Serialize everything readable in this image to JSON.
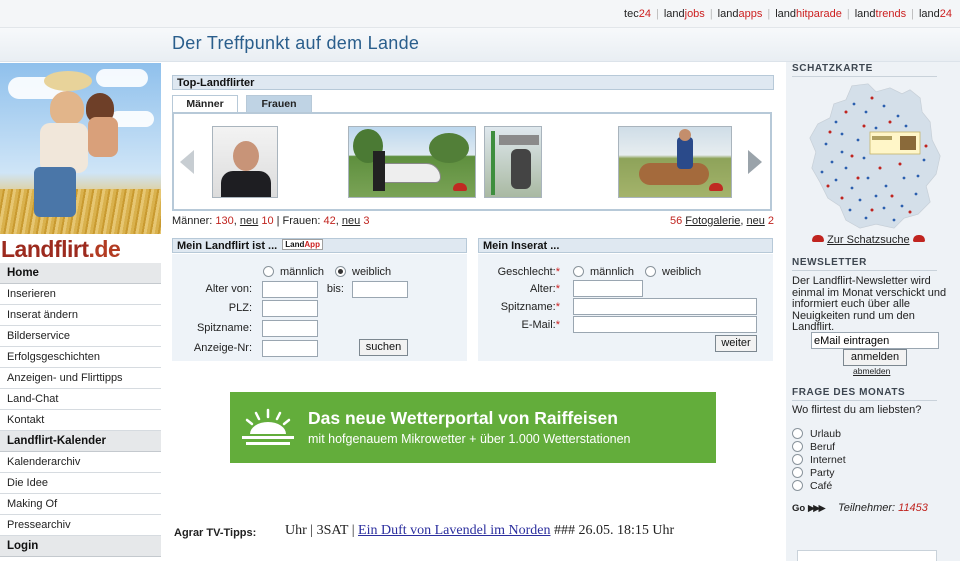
{
  "top_links": [
    {
      "pre": "tec",
      "hl": "24"
    },
    {
      "pre": "land",
      "hl": "jobs"
    },
    {
      "pre": "land",
      "hl": "apps"
    },
    {
      "pre": "land",
      "hl": "hitparade"
    },
    {
      "pre": "land",
      "hl": "trends"
    },
    {
      "pre": "land",
      "hl": "24"
    }
  ],
  "site_title": "Der Treffpunkt auf dem Lande",
  "logo": {
    "text": "Landflirt",
    "suffix": ".de"
  },
  "nav": [
    {
      "label": "Home",
      "head": true
    },
    {
      "label": "Inserieren"
    },
    {
      "label": "Inserat ändern"
    },
    {
      "label": "Bilderservice"
    },
    {
      "label": "Erfolgsgeschichten"
    },
    {
      "label": "Anzeigen- und Flirttipps"
    },
    {
      "label": "Land-Chat"
    },
    {
      "label": "Kontakt"
    },
    {
      "label": "Landflirt-Kalender",
      "head": true
    },
    {
      "label": "Kalenderarchiv"
    },
    {
      "label": "Die Idee"
    },
    {
      "label": "Making Of"
    },
    {
      "label": "Pressearchiv"
    },
    {
      "label": "Login",
      "head": true
    }
  ],
  "top_flirter": {
    "title": "Top-Landflirter",
    "tabs": [
      "Männer",
      "Frauen"
    ],
    "active_tab": "Männer"
  },
  "counts": {
    "maenner_label": "Männer:",
    "maenner": "130",
    "neu_label": "neu",
    "maenner_neu": "10",
    "frauen_label": "| Frauen:",
    "frauen": "42",
    "frauen_neu": "3",
    "galerie_count": "56",
    "galerie_label": "Fotogalerie",
    "galerie_neu": "2"
  },
  "search": {
    "title": "Mein Landflirt ist ...",
    "badge_pre": "Land",
    "badge_hl": "App",
    "options": [
      "männlich",
      "weiblich"
    ],
    "selected": "weiblich",
    "alter_von": "Alter von:",
    "bis": "bis:",
    "plz": "PLZ:",
    "spitzname": "Spitzname:",
    "anzeige_nr": "Anzeige-Nr:",
    "button": "suchen"
  },
  "inserat": {
    "title": "Mein Inserat ...",
    "geschlecht": "Geschlecht:",
    "options": [
      "männlich",
      "weiblich"
    ],
    "alter": "Alter:",
    "spitzname": "Spitzname:",
    "email": "E-Mail:",
    "button": "weiter"
  },
  "banner": {
    "headline": "Das neue Wetterportal von Raiffeisen",
    "sub": "mit hofgenauem Mikrowetter + über 1.000 Wetterstationen"
  },
  "tv": {
    "label": "Agrar TV-Tipps:",
    "pre": "Uhr | 3SAT |",
    "link": "Ein Duft von Lavendel im Norden",
    "post": "### 26.05. 18:15 Uhr"
  },
  "schatzkarte": {
    "heading": "SCHATZKARTE",
    "link": "Zur Schatzsuche"
  },
  "newsletter": {
    "heading": "NEWSLETTER",
    "text": "Der Landflirt-Newsletter wird einmal im Monat verschickt und informiert euch über alle Neuigkeiten rund um den Landflirt.",
    "email_value": "eMail eintragen",
    "button": "anmelden",
    "unsubscribe": "abmelden"
  },
  "poll": {
    "heading": "FRAGE DES MONATS",
    "question": "Wo flirtest du am liebsten?",
    "options": [
      "Urlaub",
      "Beruf",
      "Internet",
      "Party",
      "Café"
    ],
    "go": "Go",
    "participants_label": "Teilnehmer:",
    "participants": "11453"
  },
  "colors": {
    "accent_red": "#c0241f",
    "title_blue": "#2a5e8c",
    "banner_green": "#63ad3b"
  }
}
